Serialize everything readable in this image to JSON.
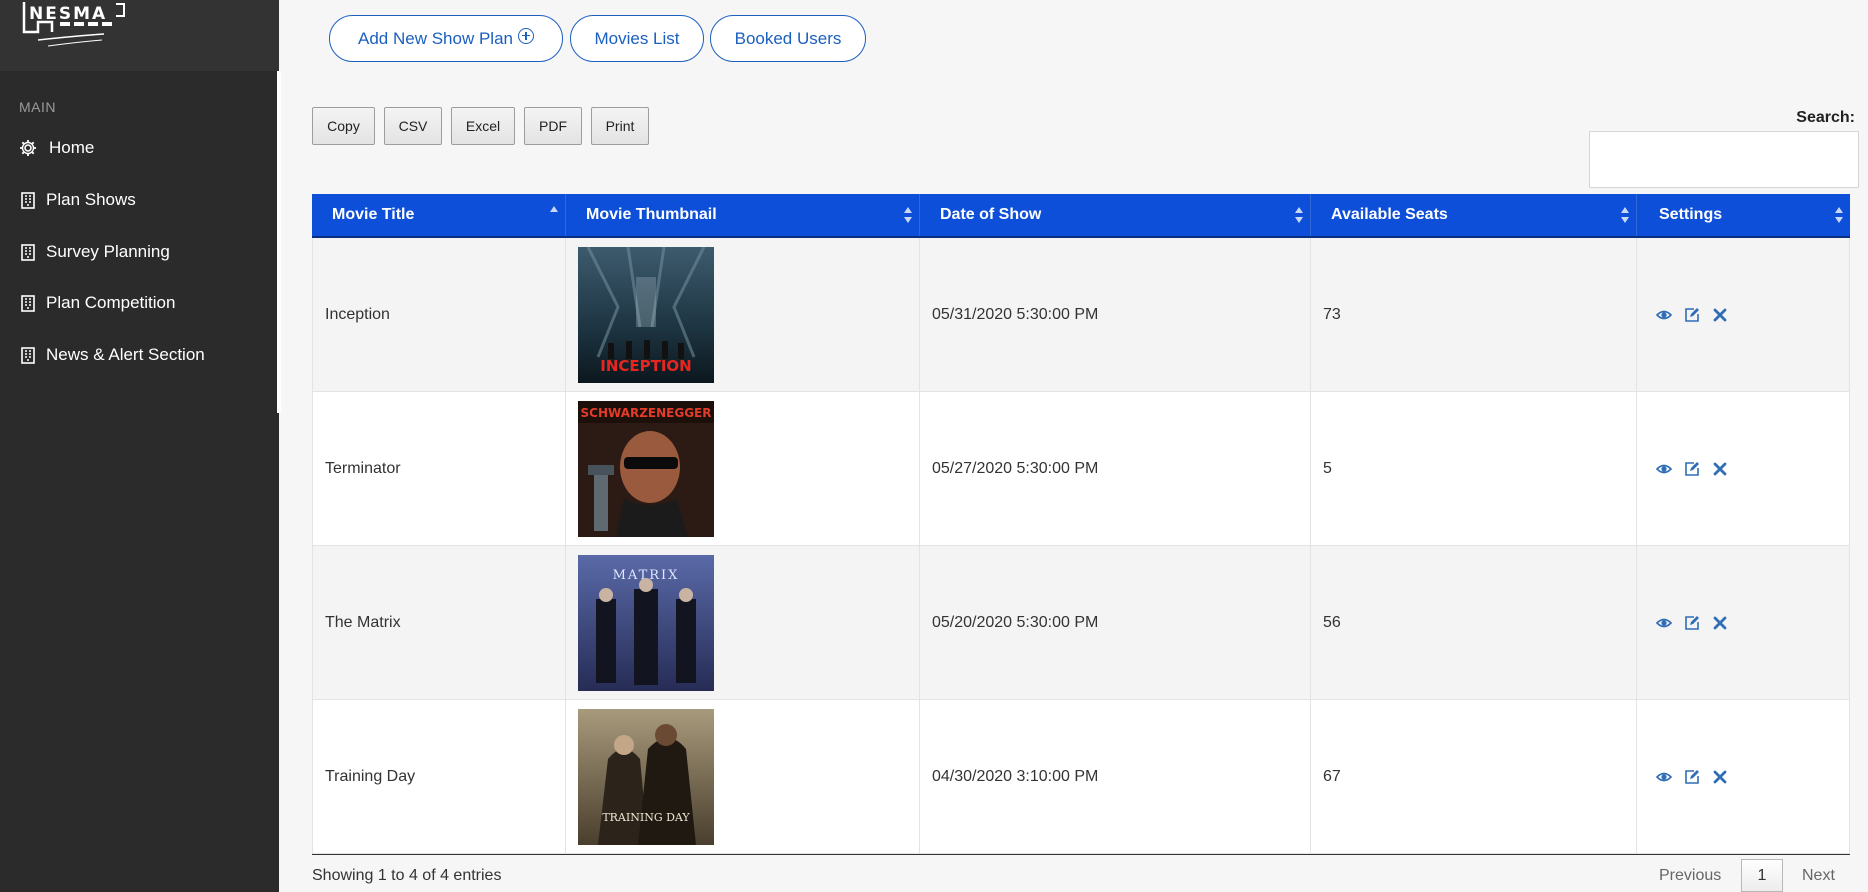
{
  "brand": {
    "logo_text": "NESMA"
  },
  "sidebar": {
    "section_label": "MAIN",
    "items": [
      {
        "label": "Home",
        "icon": "gear-icon"
      },
      {
        "label": "Plan Shows",
        "icon": "building-icon"
      },
      {
        "label": "Survey Planning",
        "icon": "building-icon"
      },
      {
        "label": "Plan Competition",
        "icon": "building-icon"
      },
      {
        "label": "News & Alert Section",
        "icon": "building-icon"
      }
    ]
  },
  "top_actions": {
    "add_plan": "Add New Show Plan",
    "movies_list": "Movies List",
    "booked_users": "Booked Users"
  },
  "export_buttons": [
    "Copy",
    "CSV",
    "Excel",
    "PDF",
    "Print"
  ],
  "search": {
    "label": "Search:",
    "value": "",
    "placeholder": ""
  },
  "table": {
    "columns": [
      "Movie Title",
      "Movie Thumbnail",
      "Date of Show",
      "Available Seats",
      "Settings"
    ],
    "rows": [
      {
        "title": "Inception",
        "thumbnail_caption": "INCEPTION",
        "date": "05/31/2020 5:30:00 PM",
        "seats": "73"
      },
      {
        "title": "Terminator",
        "thumbnail_caption": "SCHWARZENEGGER",
        "date": "05/27/2020 5:30:00 PM",
        "seats": "5"
      },
      {
        "title": "The Matrix",
        "thumbnail_caption": "MATRIX",
        "date": "05/20/2020 5:30:00 PM",
        "seats": "56"
      },
      {
        "title": "Training Day",
        "thumbnail_caption": "TRAINING DAY",
        "date": "04/30/2020 3:10:00 PM",
        "seats": "67"
      }
    ]
  },
  "footer": {
    "info": "Showing 1 to 4 of 4 entries",
    "previous": "Previous",
    "current_page": "1",
    "next": "Next"
  },
  "colors": {
    "header_blue": "#0d4fd8",
    "link_blue": "#1b5fbf",
    "sidebar_bg": "#2b2b2b",
    "action_icon": "#2f6db6"
  }
}
